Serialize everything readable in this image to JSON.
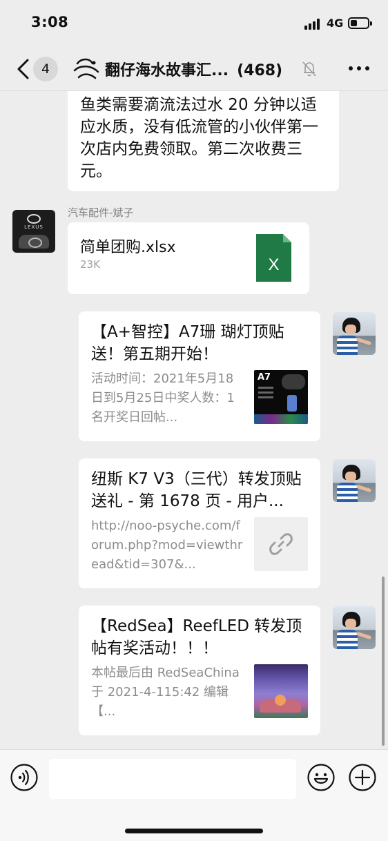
{
  "status_bar": {
    "time": "3:08",
    "network": "4G"
  },
  "nav": {
    "unread_count": "4",
    "title": "翻仔海水故事汇...",
    "member_count": "(468)"
  },
  "messages": {
    "text_message": "鱼类需要滴流法过水 20 分钟以适应水质，没有低流管的小伙伴第一次店内免费领取。第二次收费三元。",
    "file_message": {
      "sender": "汽车配件-斌子",
      "avatar_brand": "LEXUS",
      "file_name": "简单团购.xlsx",
      "file_size": "23K",
      "file_icon_letter": "X"
    },
    "link_cards": [
      {
        "title": "【A+智控】A7珊 瑚灯顶贴送！第五期开始！",
        "description": "活动时间：2021年5月18日到5月25日中奖人数：1名开奖日回帖...",
        "thumb_label": "A7"
      },
      {
        "title": "纽斯 K7 V3（三代）转发顶贴送礼 - 第 1678 页 - 用户...",
        "description": "http://noo-psyche.com/forum.php?mod=viewthread&tid=307&...",
        "thumb_icon": "link-icon"
      },
      {
        "title": "【RedSea】ReefLED 转发顶帖有奖活动！！！",
        "description": "本帖最后由 RedSeaChina 于 2021-4-115:42 编辑【..."
      }
    ]
  },
  "input_bar": {
    "placeholder": ""
  },
  "colors": {
    "background": "#ededed",
    "bubble": "#ffffff",
    "excel_green": "#1f7a45",
    "secondary_text": "#8c8c8c"
  }
}
